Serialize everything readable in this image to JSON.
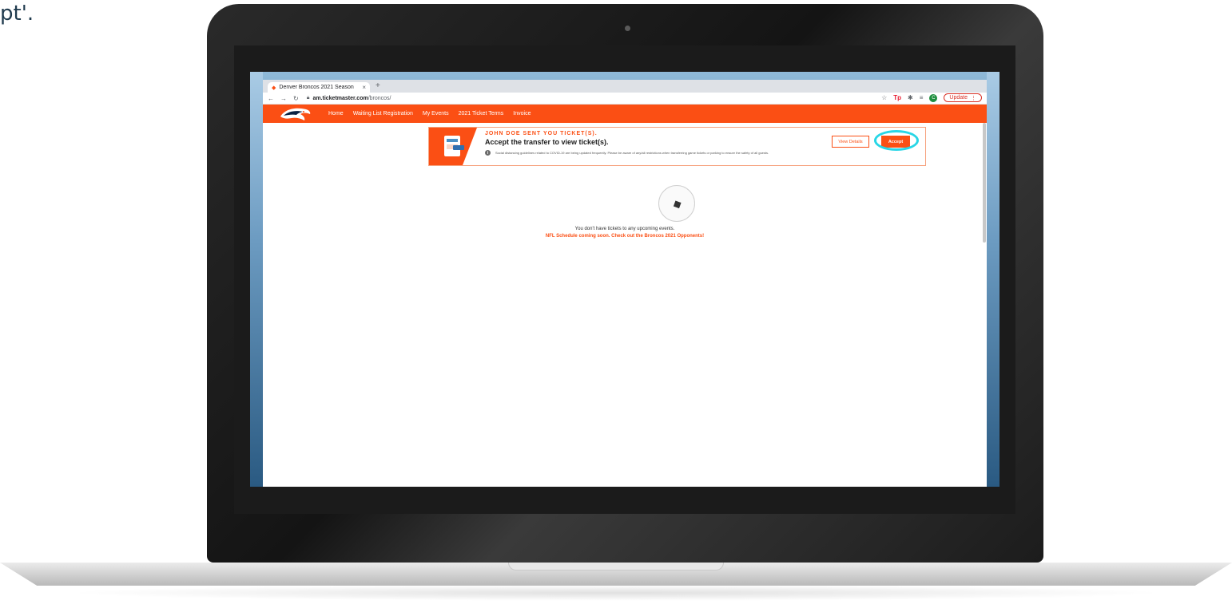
{
  "caption": "pt'.",
  "browser": {
    "tab_title": "Denver Broncos 2021 Season",
    "tab_close": "×",
    "new_tab": "+",
    "url_host": "am.ticketmaster.com",
    "url_path": "/broncos/",
    "update_label": "Update",
    "avatar_letter": "C"
  },
  "site_nav": {
    "links": [
      "Home",
      "Waiting List Registration",
      "My Events",
      "2021 Ticket Terms",
      "Invoice"
    ]
  },
  "banner": {
    "kicker": "JOHN DOE SENT YOU TICKET(S).",
    "title": "Accept the transfer to view ticket(s).",
    "note": "Social distancing guidelines related to COVID-19 are being updated frequently. Please be aware of any/all restrictions when transferring game tickets or parking to ensure the safety of all guests.",
    "view_details_label": "View Details",
    "accept_label": "Accept"
  },
  "empty_state": {
    "message": "You don't have tickets to any upcoming events.",
    "link_text": "NFL Schedule coming soon. Check out the Broncos 2021 Opponents!"
  },
  "colors": {
    "brand_orange": "#fb4f14",
    "highlight": "#27d6e6"
  }
}
